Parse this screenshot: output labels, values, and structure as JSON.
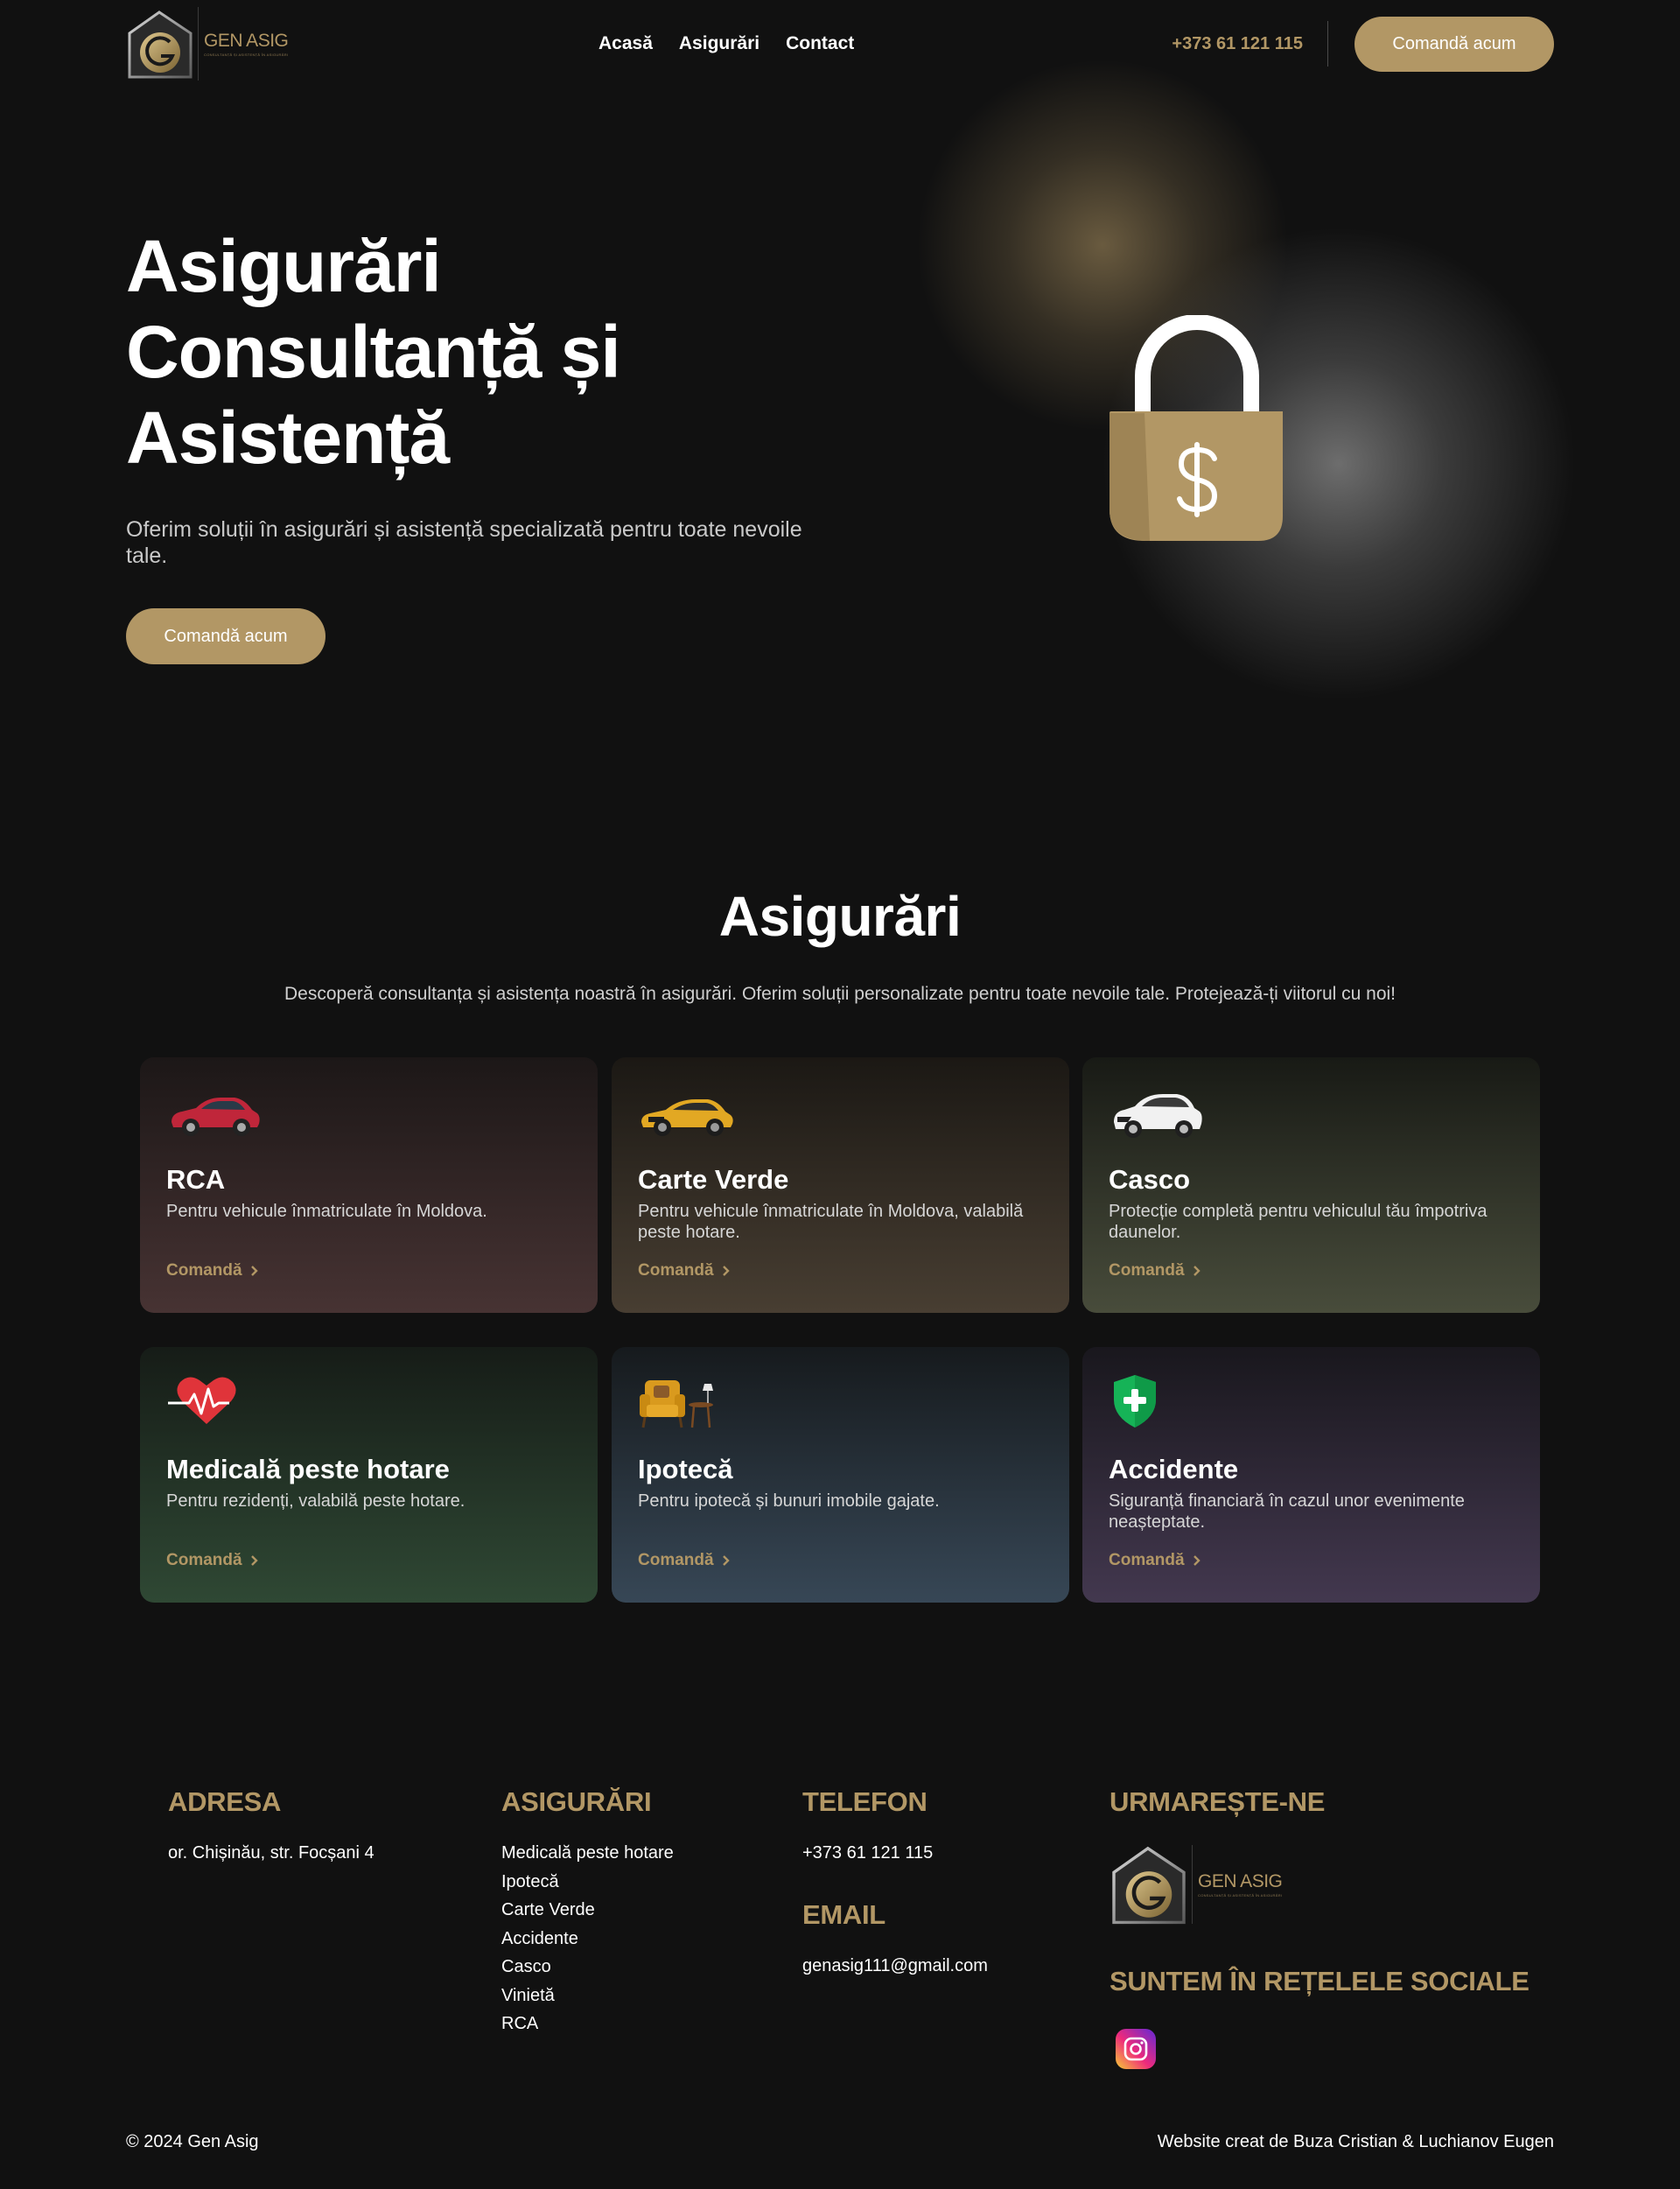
{
  "header": {
    "logo_name": "GEN ASIG",
    "logo_tagline": "CONSULTANȚĂ ȘI ASISTENȚĂ ÎN ASIGURĂRI",
    "nav": [
      "Acasă",
      "Asigurări",
      "Contact"
    ],
    "phone": "+373 61 121 115",
    "cta": "Comandă acum"
  },
  "hero": {
    "title_lines": [
      "Asigurări",
      "Consultanță și",
      "Asistență"
    ],
    "subtitle": "Oferim soluții în asigurări și asistență specializată pentru toate nevoile tale.",
    "cta": "Comandă acum",
    "illustration": "lock-dollar-icon"
  },
  "services": {
    "title": "Asigurări",
    "subtitle": "Descoperă consultanța și asistența noastră în asigurări. Oferim soluții personalizate pentru toate nevoile tale. Protejează-ți viitorul cu noi!",
    "cards": [
      {
        "title": "RCA",
        "desc": "Pentru vehicule înmatriculate în Moldova.",
        "cta": "Comandă",
        "icon": "red-car-icon"
      },
      {
        "title": "Carte Verde",
        "desc": "Pentru vehicule înmatriculate în Moldova, valabilă peste hotare.",
        "cta": "Comandă",
        "icon": "yellow-car-icon"
      },
      {
        "title": "Casco",
        "desc": "Protecție completă pentru vehiculul tău împotriva daunelor.",
        "cta": "Comandă",
        "icon": "white-suv-icon"
      },
      {
        "title": "Medicală peste hotare",
        "desc": "Pentru rezidenți, valabilă peste hotare.",
        "cta": "Comandă",
        "icon": "heart-pulse-icon"
      },
      {
        "title": "Ipotecă",
        "desc": "Pentru ipotecă și bunuri imobile gajate.",
        "cta": "Comandă",
        "icon": "armchair-icon"
      },
      {
        "title": "Accidente",
        "desc": "Siguranță financiară în cazul unor evenimente neașteptate.",
        "cta": "Comandă",
        "icon": "shield-plus-icon"
      }
    ]
  },
  "footer": {
    "address_heading": "ADRESA",
    "address": "or. Chișinău, str. Focșani 4",
    "insurance_heading": "ASIGURĂRI",
    "insurance_links": [
      "Medicală peste hotare",
      "Ipotecă",
      "Carte Verde",
      "Accidente",
      "Casco",
      "Vinietă",
      "RCA"
    ],
    "phone_heading": "TELEFON",
    "phone": "+373 61 121 115",
    "email_heading": "EMAIL",
    "email": "genasig111@gmail.com",
    "follow_heading": "URMAREȘTE-NE",
    "social_heading": "SUNTEM ÎN REȚELELE SOCIALE",
    "social_icon": "instagram-icon",
    "copyright": "© 2024 Gen Asig",
    "credit": "Website creat de Buza Cristian & Luchianov Eugen"
  },
  "colors": {
    "background": "#111111",
    "accent_gold": "#b29765",
    "text": "#ffffff",
    "muted": "#c9c9c9"
  }
}
